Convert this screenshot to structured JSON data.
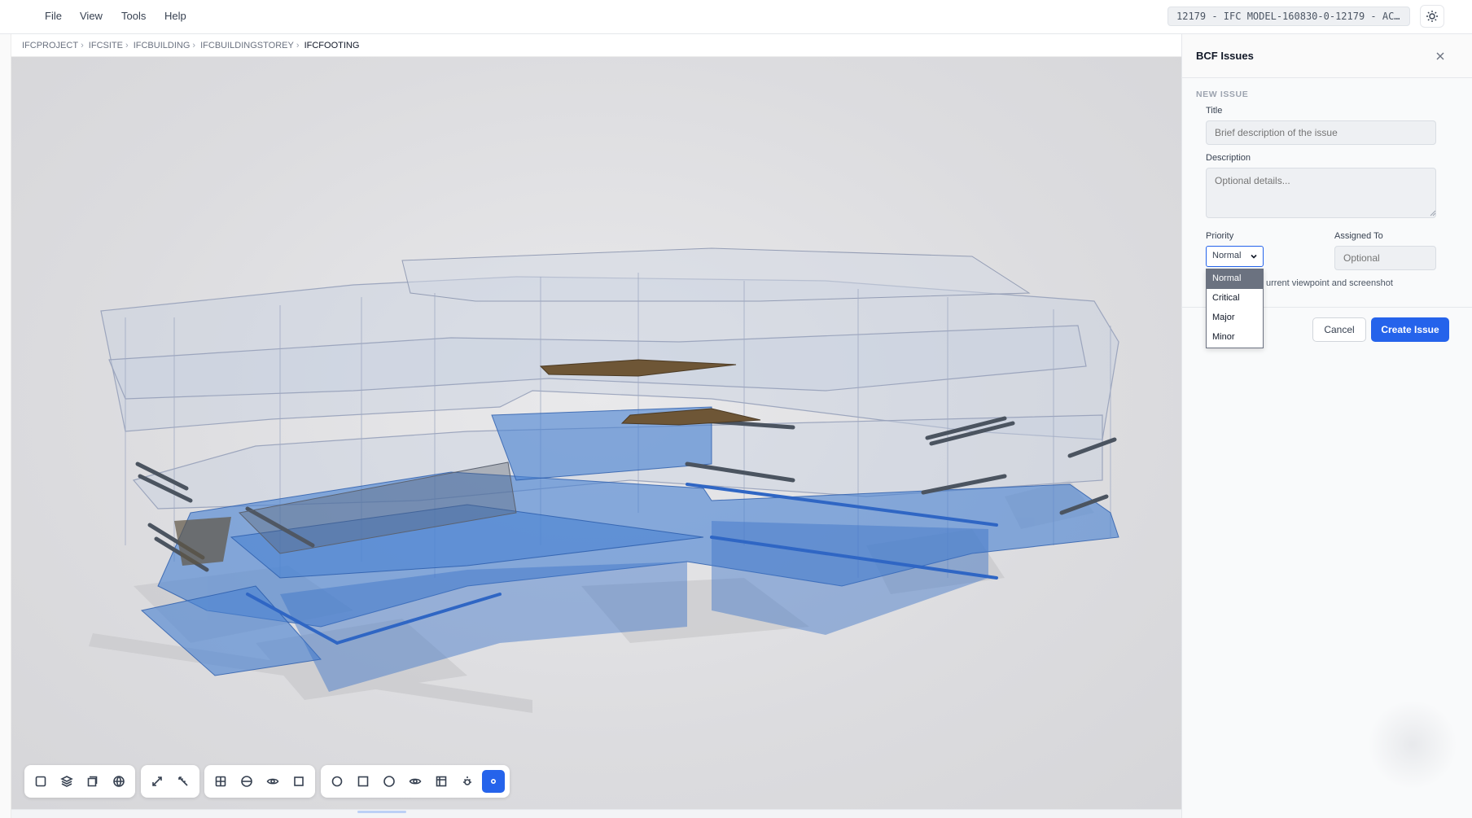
{
  "menubar": {
    "items": [
      "File",
      "View",
      "Tools",
      "Help"
    ],
    "file_name": "12179 - IFC MODEL-160830-0-12179 - AC…",
    "theme_toggle_icon": "sun-icon"
  },
  "breadcrumb": [
    "IFCPROJECT",
    "IFCSITE",
    "IFCBUILDING",
    "IFCBUILDINGSTOREY",
    "IFCFOOTING"
  ],
  "toolbar": {
    "groups": [
      [
        "select-box-icon",
        "layers-icon",
        "section-box-icon",
        "globe-icon"
      ],
      [
        "expand-icon",
        "measure-icon"
      ],
      [
        "grid-icon",
        "clip-plane-icon",
        "eye-icon",
        "frame-icon"
      ],
      [
        "circle-icon",
        "square-icon",
        "sphere-icon",
        "visibility-icon",
        "table-icon",
        "light-icon",
        "target-icon"
      ]
    ],
    "active_tool": "target-icon",
    "accent_color": "#2563eb"
  },
  "bcf_panel": {
    "title": "BCF Issues",
    "section": "NEW ISSUE",
    "title_label": "Title",
    "title_placeholder": "Brief description of the issue",
    "description_label": "Description",
    "description_placeholder": "Optional details...",
    "priority_label": "Priority",
    "priority_value": "Normal",
    "priority_options": [
      "Normal",
      "Critical",
      "Major",
      "Minor"
    ],
    "assigned_label": "Assigned To",
    "assigned_placeholder": "Optional",
    "viewpoint_text": "urrent viewpoint and screenshot",
    "cancel_label": "Cancel",
    "create_label": "Create Issue"
  }
}
